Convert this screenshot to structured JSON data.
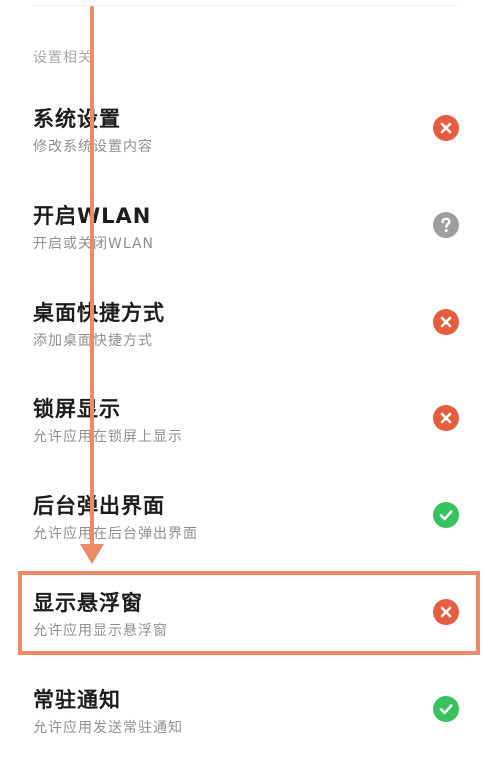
{
  "section_header": "设置相关",
  "permissions": [
    {
      "title": "系统设置",
      "subtitle": "修改系统设置内容",
      "status": "denied",
      "icon": "close-icon"
    },
    {
      "title": "开启WLAN",
      "subtitle": "开启或关闭WLAN",
      "status": "unknown",
      "icon": "question-icon"
    },
    {
      "title": "桌面快捷方式",
      "subtitle": "添加桌面快捷方式",
      "status": "denied",
      "icon": "close-icon"
    },
    {
      "title": "锁屏显示",
      "subtitle": "允许应用在锁屏上显示",
      "status": "denied",
      "icon": "close-icon"
    },
    {
      "title": "后台弹出界面",
      "subtitle": "允许应用在后台弹出界面",
      "status": "granted",
      "icon": "check-icon"
    },
    {
      "title": "显示悬浮窗",
      "subtitle": "允许应用显示悬浮窗",
      "status": "denied",
      "icon": "close-icon"
    },
    {
      "title": "常驻通知",
      "subtitle": "允许应用发送常驻通知",
      "status": "granted",
      "icon": "check-icon"
    }
  ],
  "colors": {
    "denied": "#e85d3d",
    "unknown": "#9e9e9e",
    "granted": "#36c25e",
    "annotation": "#ef8a66"
  }
}
